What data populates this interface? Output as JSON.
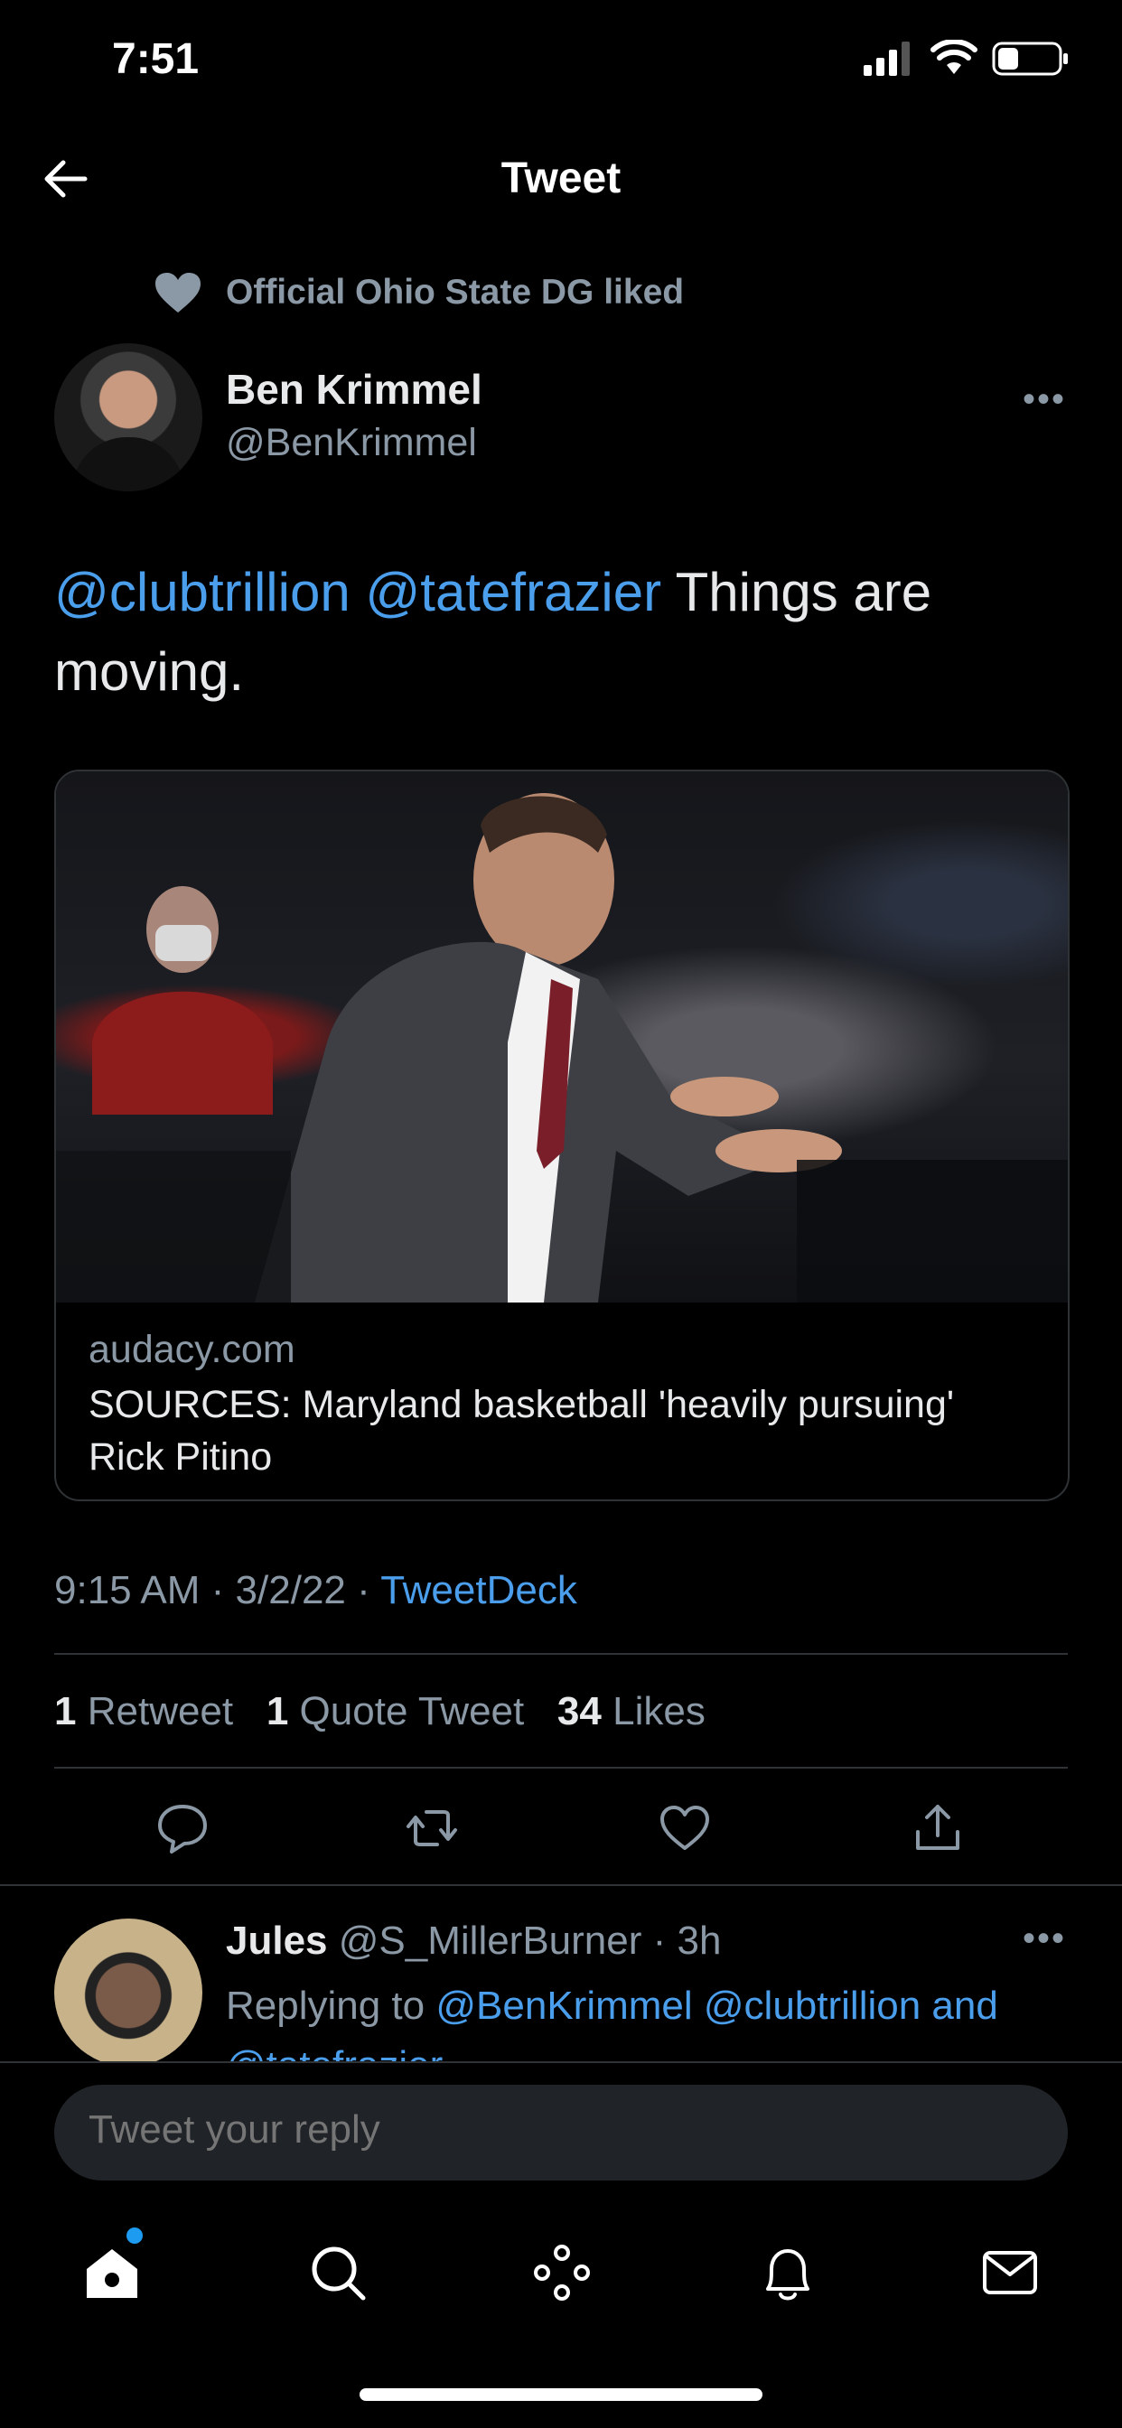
{
  "status_bar": {
    "time": "7:51"
  },
  "header": {
    "title": "Tweet"
  },
  "social_context": {
    "text": "Official Ohio State DG liked"
  },
  "tweet": {
    "author_name": "Ben Krimmel",
    "author_handle": "@BenKrimmel",
    "mention1": "@clubtrillion",
    "mention2": "@tatefrazier",
    "text": "Things are moving.",
    "card": {
      "domain": "audacy.com",
      "headline": "SOURCES: Maryland basketball 'heavily pursuing' Rick Pitino"
    },
    "time": "9:15 AM",
    "date": "3/2/22",
    "via": "TweetDeck",
    "separator": " · ",
    "stats": {
      "retweets_count": "1",
      "retweets_label": "Retweet",
      "quotes_count": "1",
      "quotes_label": "Quote Tweet",
      "likes_count": "34",
      "likes_label": "Likes"
    }
  },
  "reply": {
    "name": "Jules",
    "handle": "@S_MillerBurner",
    "age": "3h",
    "replying_prefix": "Replying to",
    "replying_to": "@BenKrimmel @clubtrillion and @tatefrazier"
  },
  "composer": {
    "placeholder": "Tweet your reply"
  },
  "colors": {
    "accent": "#1d9bf0",
    "link": "#4a9eeb",
    "background": "#000000",
    "muted": "#8b98a5"
  }
}
